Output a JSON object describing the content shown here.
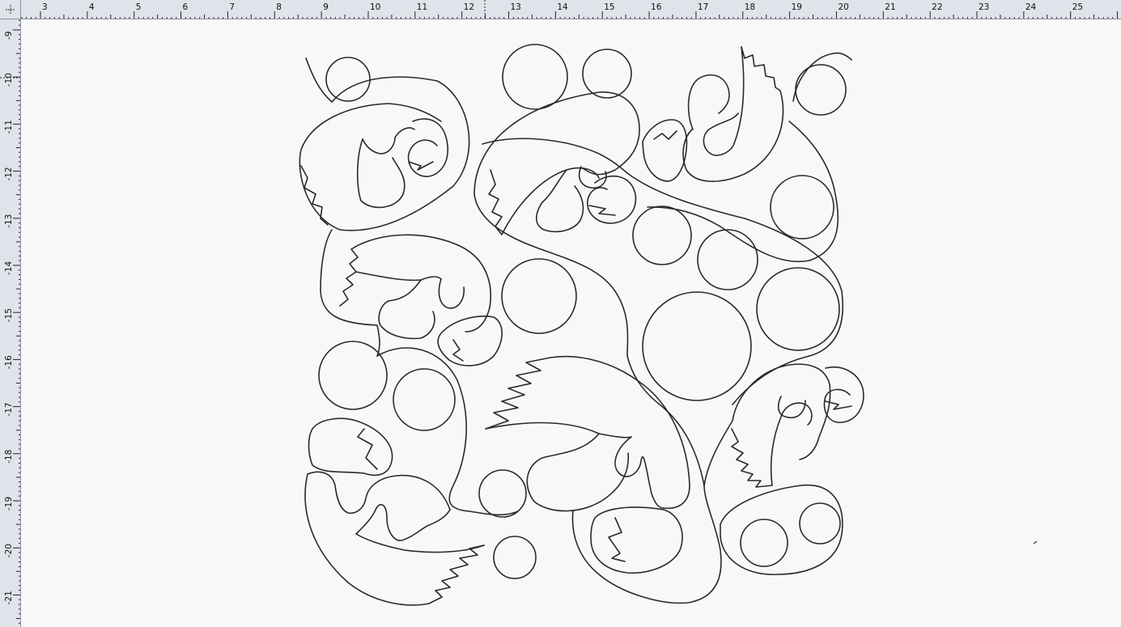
{
  "rulers": {
    "unit_marker": "⁚",
    "horizontal": {
      "labels": [
        "3",
        "4",
        "5",
        "6",
        "7",
        "8",
        "9",
        "10",
        "11",
        "12",
        "13",
        "14",
        "15",
        "16",
        "17",
        "18",
        "19",
        "20",
        "21",
        "22",
        "23",
        "24",
        "25"
      ],
      "first_value": 3,
      "last_value": 25
    },
    "vertical": {
      "labels": [
        "9",
        "10",
        "11",
        "12",
        "13",
        "14",
        "15",
        "16",
        "17",
        "18",
        "19",
        "20",
        "21"
      ],
      "first_value": 9,
      "last_value": 21,
      "negative": true
    }
  },
  "canvas": {
    "background": "#f8f8f8",
    "line_color": "#2a2a2a",
    "design": "quilting-motif-outline"
  },
  "colors": {
    "ruler_bg": "#dfe3ea",
    "ruler_border": "#8e949c",
    "ruler_text": "#111111"
  }
}
